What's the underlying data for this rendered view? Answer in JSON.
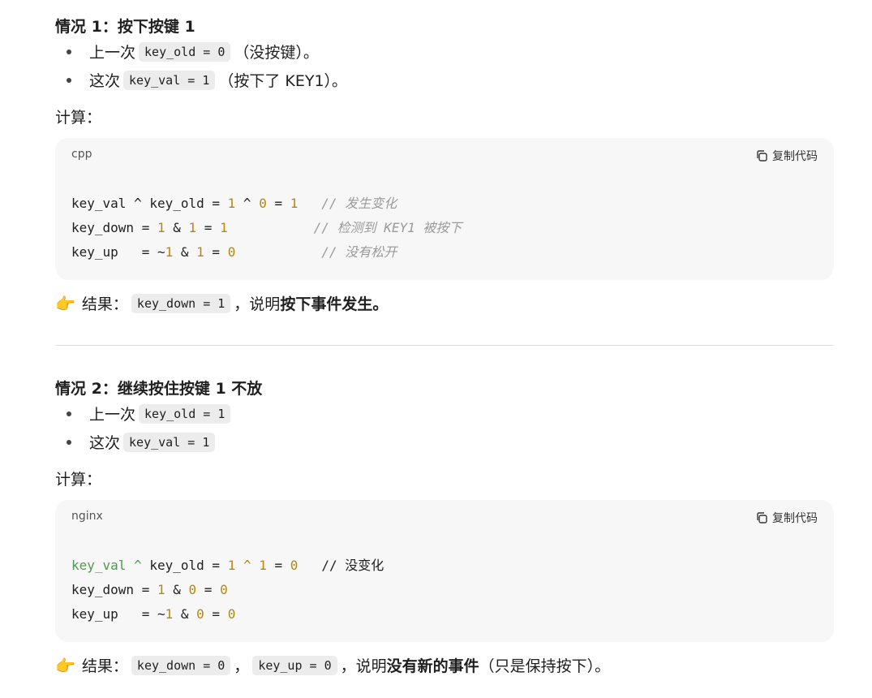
{
  "case1": {
    "title": "情况 1：按下按键 1",
    "bullet1": {
      "prefix": "上一次",
      "code": "key_old = 0",
      "suffix": "（没按键）。"
    },
    "bullet2": {
      "prefix": "这次",
      "code": "key_val = 1",
      "suffix": "（按下了 KEY1）。"
    },
    "calc_label": "计算：",
    "code": {
      "lang": "cpp",
      "copy_label": "复制代码",
      "lines": [
        [
          {
            "t": "key_val ^ key_old = "
          },
          {
            "t": "1",
            "c": "num"
          },
          {
            "t": " ^ "
          },
          {
            "t": "0",
            "c": "num"
          },
          {
            "t": " = "
          },
          {
            "t": "1",
            "c": "num"
          },
          {
            "t": "   "
          },
          {
            "t": "// 发生变化",
            "c": "comm"
          }
        ],
        [
          {
            "t": "key_down = "
          },
          {
            "t": "1",
            "c": "num"
          },
          {
            "t": " & "
          },
          {
            "t": "1",
            "c": "num"
          },
          {
            "t": " = "
          },
          {
            "t": "1",
            "c": "num"
          },
          {
            "t": "           "
          },
          {
            "t": "// 检测到 KEY1 被按下",
            "c": "comm"
          }
        ],
        [
          {
            "t": "key_up   = ~"
          },
          {
            "t": "1",
            "c": "num"
          },
          {
            "t": " & "
          },
          {
            "t": "1",
            "c": "num"
          },
          {
            "t": " = "
          },
          {
            "t": "0",
            "c": "num"
          },
          {
            "t": "           "
          },
          {
            "t": "// 没有松开",
            "c": "comm"
          }
        ]
      ]
    },
    "result": {
      "emoji": "👉",
      "prefix": "结果：",
      "code": "key_down = 1",
      "mid": "，说明 ",
      "bold": "按下事件发生",
      "suffix": "。"
    }
  },
  "case2": {
    "title": "情况 2：继续按住按键 1 不放",
    "bullet1": {
      "prefix": "上一次",
      "code": "key_old = 1"
    },
    "bullet2": {
      "prefix": "这次",
      "code": "key_val = 1"
    },
    "calc_label": "计算：",
    "code": {
      "lang": "nginx",
      "copy_label": "复制代码",
      "lines": [
        [
          {
            "t": "key_val",
            "c": "ident-green"
          },
          {
            "t": " "
          },
          {
            "t": "^",
            "c": "ident-green"
          },
          {
            "t": " key_old = "
          },
          {
            "t": "1",
            "c": "num"
          },
          {
            "t": " "
          },
          {
            "t": "^",
            "c": "num"
          },
          {
            "t": " "
          },
          {
            "t": "1",
            "c": "num"
          },
          {
            "t": " = "
          },
          {
            "t": "0",
            "c": "num"
          },
          {
            "t": "   "
          },
          {
            "t": "// 没变化",
            "c": "plaincomm"
          }
        ],
        [
          {
            "t": "key_down = "
          },
          {
            "t": "1",
            "c": "num"
          },
          {
            "t": " & "
          },
          {
            "t": "0",
            "c": "num"
          },
          {
            "t": " = "
          },
          {
            "t": "0",
            "c": "num"
          }
        ],
        [
          {
            "t": "key_up   = ~"
          },
          {
            "t": "1",
            "c": "num"
          },
          {
            "t": " & "
          },
          {
            "t": "0",
            "c": "num"
          },
          {
            "t": " = "
          },
          {
            "t": "0",
            "c": "num"
          }
        ]
      ]
    },
    "result": {
      "emoji": "👉",
      "prefix": "结果：",
      "code1": "key_down = 0",
      "sep": "，",
      "code2": "key_up = 0",
      "mid": "，说明 ",
      "bold": "没有新的事件",
      "suffix": "（只是保持按下）。"
    }
  }
}
